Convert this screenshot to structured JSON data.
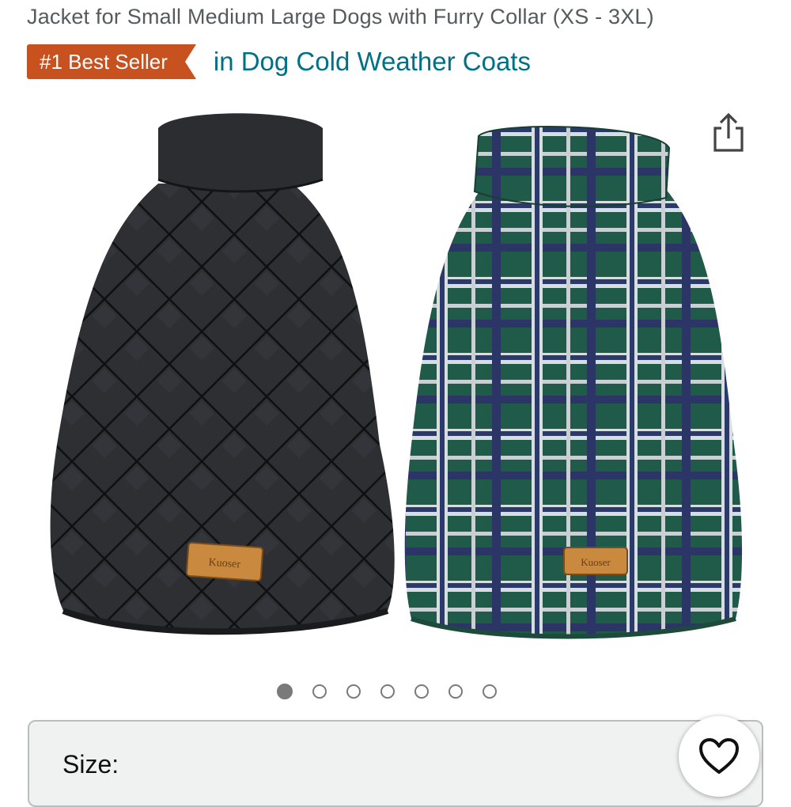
{
  "product": {
    "title": "Jacket for Small Medium Large Dogs with Furry Collar (XS - 3XL)"
  },
  "badge": {
    "label": "#1 Best Seller",
    "category_link": "in Dog Cold Weather Coats",
    "color": "#c7511f",
    "link_color": "#007185"
  },
  "gallery": {
    "images": [
      {
        "name": "black-quilted-coat",
        "tag_text": "Kuoser"
      },
      {
        "name": "green-plaid-coat",
        "tag_text": "Kuoser"
      }
    ],
    "total_images": 7,
    "active_index": 1
  },
  "icons": {
    "share": "share-icon",
    "wishlist": "heart-icon"
  },
  "size": {
    "label": "Size:"
  }
}
